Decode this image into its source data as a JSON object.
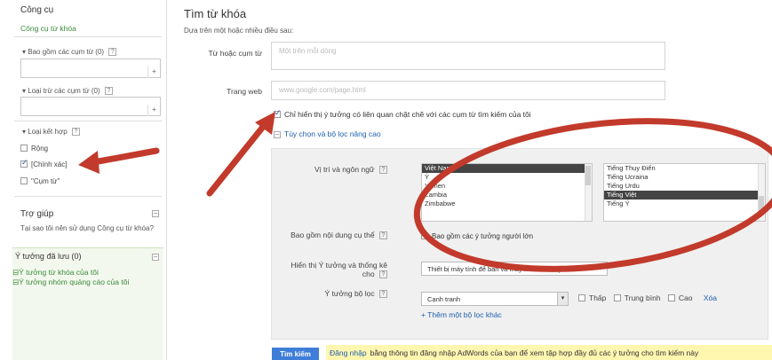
{
  "sidebar": {
    "title": "Công cụ",
    "tool_link": "Công cụ từ khóa",
    "include_terms": "Bao gồm các cụm từ (0)",
    "exclude_terms": "Loại trừ các cụm từ (0)",
    "match_types": "Loại kết hợp",
    "match_broad": "Rộng",
    "match_exact": "[Chính xác]",
    "match_phrase": "\"Cụm từ\"",
    "help_title": "Trợ giúp",
    "help_question": "Tại sao tôi nên sử dụng Công cụ từ khóa?",
    "saved_title": "Ý tưởng đã lưu (0)",
    "saved_keyword_ideas": "Ý tưởng từ khóa của tôi",
    "saved_adgroup_ideas": "Ý tưởng nhóm quảng cáo của tôi",
    "plus_label": "+",
    "minus_label": "–",
    "help_icon": "?"
  },
  "main": {
    "title": "Tìm từ khóa",
    "subtitle": "Dựa trên một hoặc nhiều điều sau:",
    "word_label": "Từ hoặc cụm từ",
    "word_placeholder": "Một trên mỗi dòng",
    "website_label": "Trang web",
    "website_placeholder": "www.google.com/page.html",
    "closely_related": "Chỉ hiển thị ý tưởng có liên quan chặt chẽ với các cụm từ tìm kiếm của tôi",
    "advanced_toggle": "Tùy chọn và bộ lọc nâng cao"
  },
  "advanced": {
    "location_label": "Vị trí và ngôn ngữ",
    "locations": [
      "Việt Nam",
      "Ý",
      "Yemen",
      "Zambia",
      "Zimbabwe"
    ],
    "locations_selected": 0,
    "languages": [
      "Tiếng Thụy Điển",
      "Tiếng Ucraina",
      "Tiếng Urdu",
      "Tiếng Việt",
      "Tiếng Ý"
    ],
    "languages_selected": 3,
    "adult_label": "Bao gồm nội dung cụ thể",
    "adult_checkbox": "Bao gồm các ý tưởng người lớn",
    "show_ideas_label": "Hiển thị Ý tưởng và thống kê cho",
    "device_value": "Thiết bị máy tính để bàn và máy tính xách tay",
    "filter_label": "Ý tưởng bộ lọc",
    "filter_value": "Cạnh tranh",
    "filter_low": "Thấp",
    "filter_medium": "Trung bình",
    "filter_high": "Cao",
    "filter_clear": "Xóa",
    "add_filter": "+ Thêm một bộ lọc khác"
  },
  "footer": {
    "search_button": "Tìm kiếm",
    "signin_link": "Đăng nhập",
    "signin_text": "bằng thông tin đăng nhập AdWords của bạn để xem tập hợp đầy đủ các ý tưởng cho tìm kiếm này"
  },
  "colors": {
    "accent_green": "#3a8a3a",
    "link_blue": "#1d5fae",
    "annotation_red": "#c23a2b",
    "search_blue": "#3e7ed8",
    "notice_yellow": "#fff6b0"
  }
}
